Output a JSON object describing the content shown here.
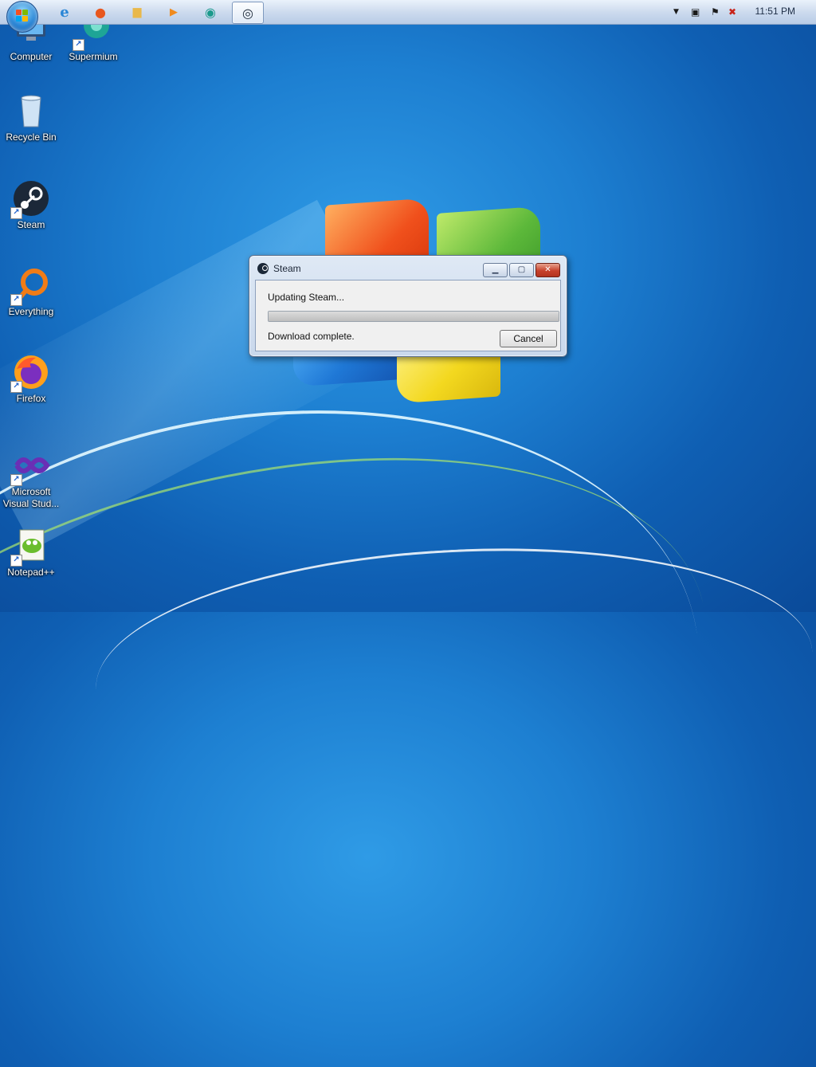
{
  "taskbar": {
    "pinned": [
      {
        "name": "internet-explorer-icon",
        "glyph": "e",
        "color": "#2a86d6"
      },
      {
        "name": "firefox-icon",
        "glyph": "●",
        "color": "#e8571e"
      },
      {
        "name": "file-explorer-icon",
        "glyph": "▆",
        "color": "#e9b84a"
      },
      {
        "name": "media-player-icon",
        "glyph": "▶",
        "color": "#f08a1d"
      },
      {
        "name": "supermium-icon",
        "glyph": "◉",
        "color": "#1b9a8c"
      },
      {
        "name": "steam-icon",
        "glyph": "◎",
        "color": "#1b2838"
      }
    ],
    "clock": "11:51 PM"
  },
  "desktop": {
    "icons": [
      {
        "label": "Computer"
      },
      {
        "label": "Supermium"
      },
      {
        "label": "Recycle Bin"
      },
      {
        "label": "Steam"
      },
      {
        "label": "Everything"
      },
      {
        "label": "Firefox"
      },
      {
        "label": "Microsoft Visual Stud..."
      },
      {
        "label": "Notepad++"
      }
    ]
  },
  "dialog": {
    "title": "Steam",
    "status": "Updating Steam...",
    "detail": "Download complete.",
    "cancel": "Cancel",
    "progress": 1.0
  }
}
